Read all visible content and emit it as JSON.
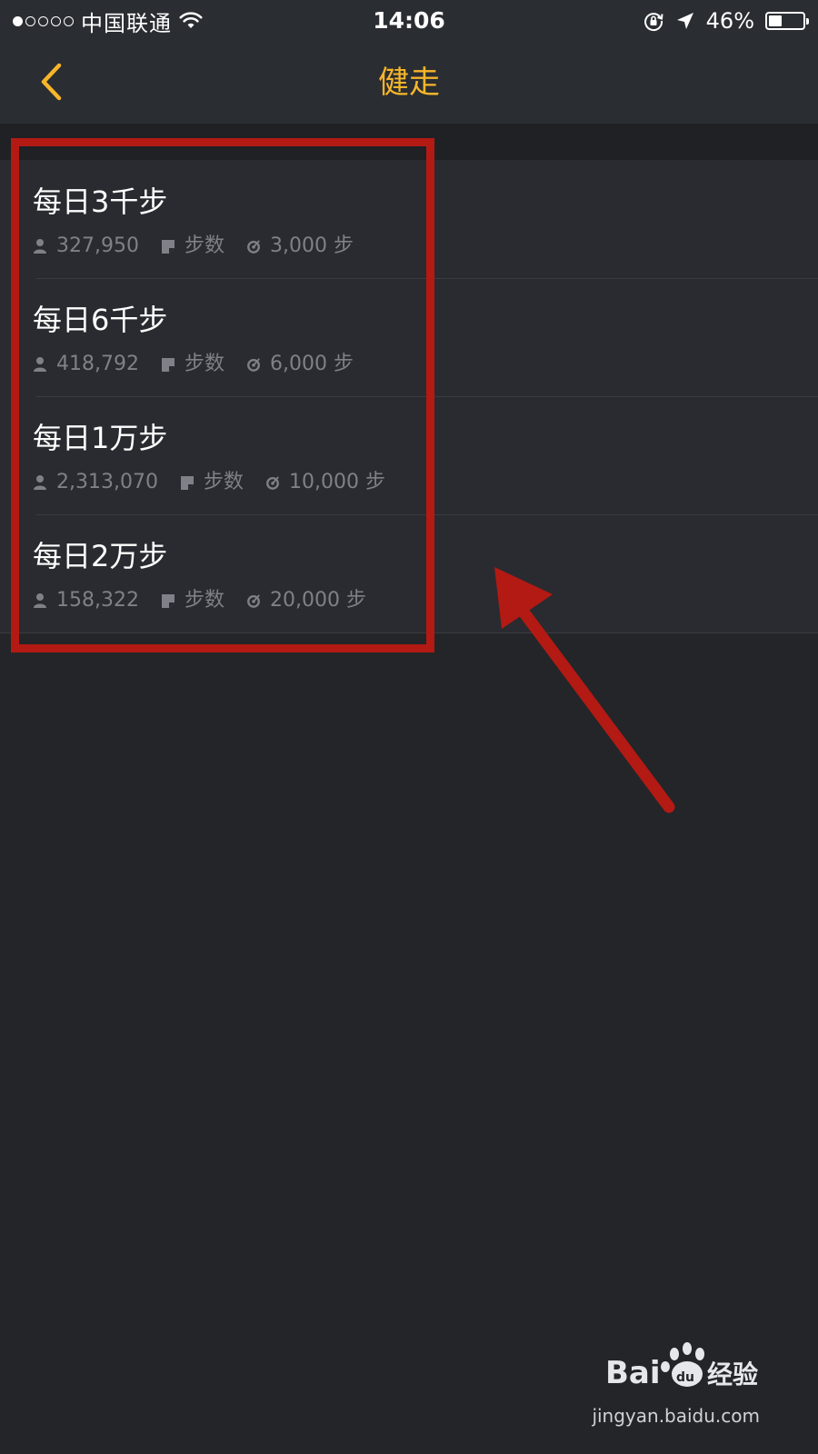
{
  "status_bar": {
    "carrier": "中国联通",
    "signal_bars_filled": 1,
    "signal_bars_total": 5,
    "time": "14:06",
    "battery_percent": "46%",
    "battery_level": 0.46,
    "icons": [
      "wifi-icon",
      "rotation-lock-icon",
      "location-arrow-icon",
      "battery-icon"
    ]
  },
  "nav_bar": {
    "title": "健走",
    "back_icon": "chevron-left-icon",
    "accent_color": "#f7b52a"
  },
  "list": {
    "items": [
      {
        "title": "每日3千步",
        "participants": "327,950",
        "category": "步数",
        "goal": "3,000 步"
      },
      {
        "title": "每日6千步",
        "participants": "418,792",
        "category": "步数",
        "goal": "6,000 步"
      },
      {
        "title": "每日1万步",
        "participants": "2,313,070",
        "category": "步数",
        "goal": "10,000 步"
      },
      {
        "title": "每日2万步",
        "participants": "158,322",
        "category": "步数",
        "goal": "20,000 步"
      }
    ],
    "meta_icons": [
      "person-icon",
      "note-icon",
      "target-icon"
    ]
  },
  "annotation": {
    "color": "#b21a13"
  },
  "watermark": {
    "logo_text": "Baidu经验",
    "url": "jingyan.baidu.com"
  }
}
